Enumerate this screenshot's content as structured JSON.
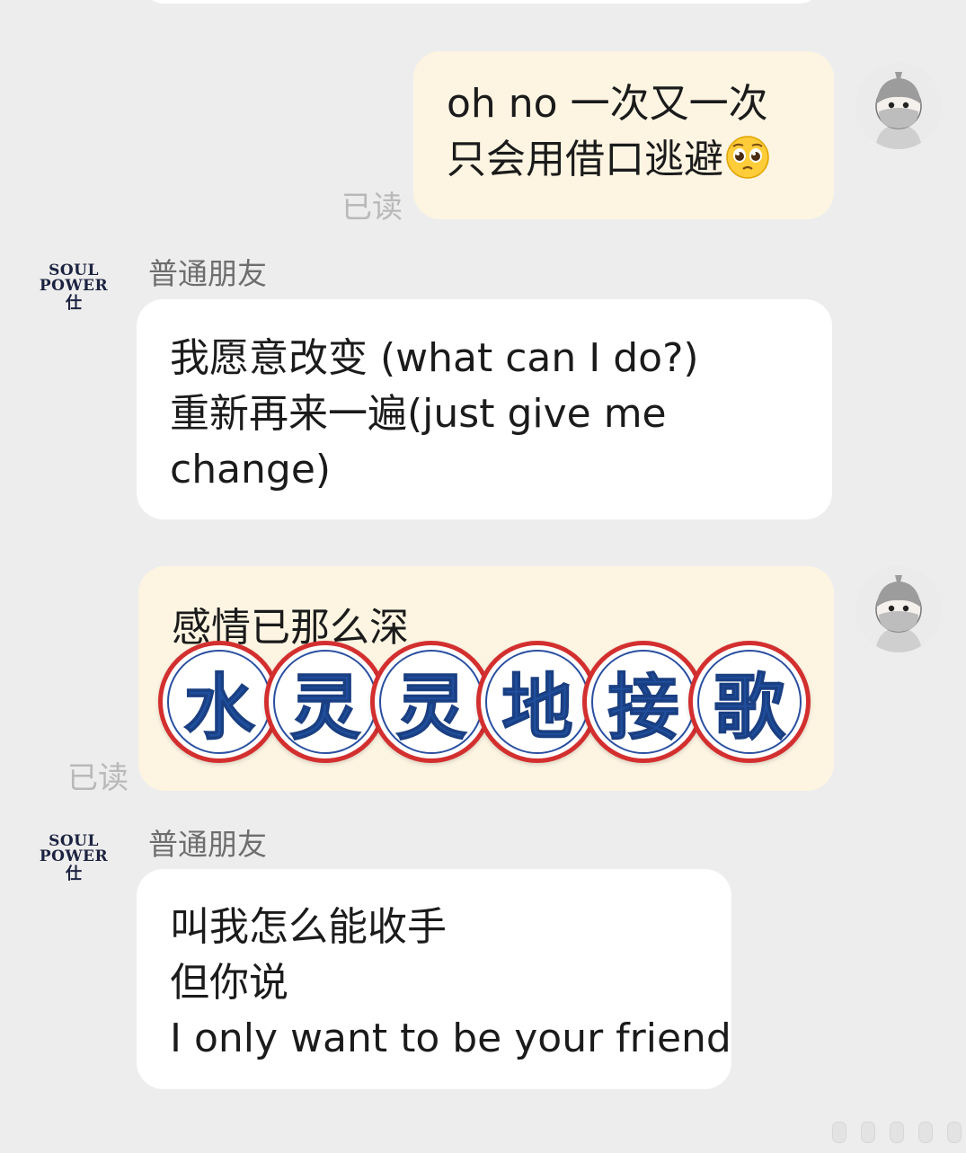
{
  "chat": {
    "messages": [
      {
        "role": "self",
        "read_label": "已读",
        "lines": [
          "oh no 一次又一次",
          "只会用借口逃避"
        ],
        "emoji": "pleading-face-icon"
      },
      {
        "role": "other",
        "sender": "普通朋友",
        "avatar": {
          "line1": "SOUL",
          "line2": "POWER",
          "mark": "仕"
        },
        "lines": [
          "我愿意改变 (what can I do?)",
          "重新再来一遍(just give me",
          "change)"
        ]
      },
      {
        "role": "self",
        "read_label": "已读",
        "lines": [
          "感情已那么深"
        ],
        "sticker": [
          "水",
          "灵",
          "灵",
          "地",
          "接",
          "歌"
        ]
      },
      {
        "role": "other",
        "sender": "普通朋友",
        "avatar": {
          "line1": "SOUL",
          "line2": "POWER",
          "mark": "仕"
        },
        "lines": [
          "叫我怎么能收手",
          "但你说",
          "I only want to be your friend"
        ]
      }
    ]
  },
  "colors": {
    "background": "#ededed",
    "self_bubble": "#fdf5e2",
    "other_bubble": "#ffffff",
    "read_label": "#b9b9b9",
    "sticker_ring": "#d32f2f",
    "sticker_text": "#1f4f9e"
  }
}
